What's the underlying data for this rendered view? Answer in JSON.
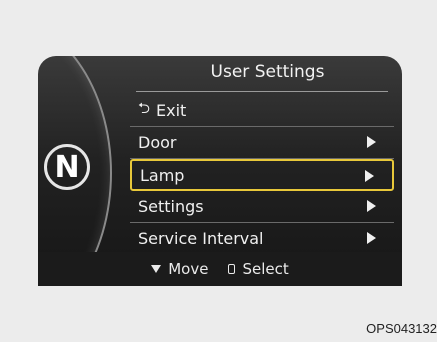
{
  "screen": {
    "title": "User Settings",
    "gear": "N",
    "menu": {
      "exit": {
        "label": "Exit",
        "icon": "return-arrow-icon"
      },
      "items": [
        {
          "label": "Door",
          "has_submenu": true,
          "selected": false
        },
        {
          "label": "Lamp",
          "has_submenu": true,
          "selected": true
        },
        {
          "label": "Settings",
          "has_submenu": true,
          "selected": false
        },
        {
          "label": "Service Interval",
          "has_submenu": true,
          "selected": false
        }
      ]
    },
    "footer": {
      "move_label": "Move",
      "move_icon": "down-triangle-icon",
      "select_label": "Select",
      "select_icon": "select-button-icon"
    }
  },
  "caption": "OPS043132",
  "colors": {
    "highlight": "#e8c83a",
    "text": "#f0f0f0"
  }
}
